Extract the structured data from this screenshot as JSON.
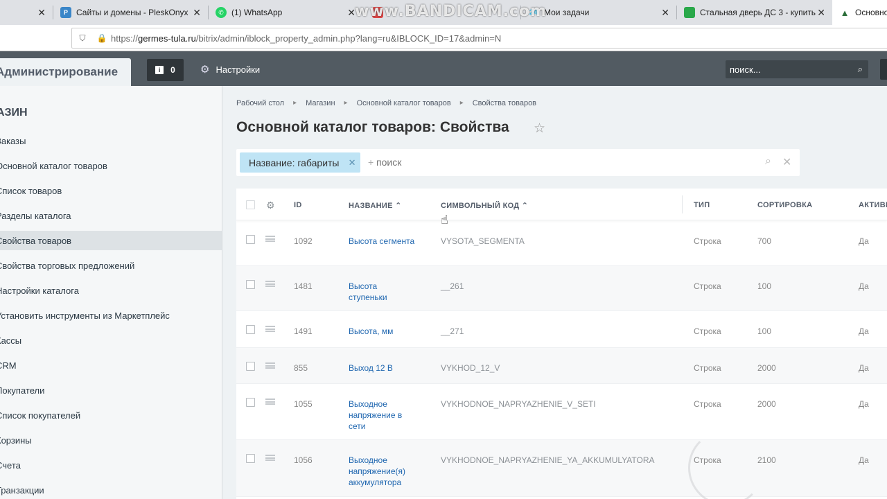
{
  "browser": {
    "tabs": [
      {
        "title": "Сайты и домены - PleskOnyx",
        "favicon": "plesk-icon"
      },
      {
        "title": "(1) WhatsApp",
        "favicon": "whatsapp-icon"
      },
      {
        "title": "",
        "favicon": "generic-icon"
      },
      {
        "title": "Мои задачи",
        "favicon": "bitrix24-icon"
      },
      {
        "title": "Стальная дверь ДС 3 - купить",
        "favicon": "green-square-icon"
      },
      {
        "title": "Основной",
        "favicon": "triangle-icon"
      }
    ],
    "watermark": "www.BANDICAM.com",
    "url_prefix": "https://",
    "url_host": "germes-tula.ru",
    "url_path": "/bitrix/admin/iblock_property_admin.php?lang=ru&IBLOCK_ID=17&admin=N"
  },
  "header": {
    "admin_title": "Администрирование",
    "notification_count": "0",
    "settings_label": "Настройки",
    "search_placeholder": "поиск..."
  },
  "menu": {
    "heading": "МАГАЗИН",
    "items": [
      "Заказы",
      "Основной каталог товаров",
      "Список товаров",
      "Разделы каталога",
      "Свойства товаров",
      "Свойства торговых предложений",
      "Настройки каталога",
      "Установить инструменты из Маркетплейс",
      "Кассы",
      "CRM",
      "Покупатели",
      "Список покупателей",
      "Корзины",
      "Счета",
      "Транзакции"
    ],
    "active_index": 4
  },
  "breadcrumbs": [
    "Рабочий стол",
    "Магазин",
    "Основной каталог товаров",
    "Свойства товаров"
  ],
  "page_title": "Основной каталог товаров: Свойства",
  "filter": {
    "tag": "Название: габариты",
    "plus": "+",
    "placeholder": "поиск"
  },
  "grid": {
    "columns": [
      "ID",
      "НАЗВАНИЕ",
      "СИМВОЛЬНЫЙ КОД",
      "ТИП",
      "СОРТИРОВКА",
      "АКТИВН"
    ],
    "sort_arrow": "^",
    "rows": [
      {
        "id": "1092",
        "name": "Высота сегмента",
        "code": "VYSOTA_SEGMENTA",
        "type": "Строка",
        "sort": "700",
        "active": "Да"
      },
      {
        "id": "1481",
        "name": "Высота ступеньки",
        "code": "__261",
        "type": "Строка",
        "sort": "100",
        "active": "Да"
      },
      {
        "id": "1491",
        "name": "Высота, мм",
        "code": "__271",
        "type": "Строка",
        "sort": "100",
        "active": "Да"
      },
      {
        "id": "855",
        "name": "Выход 12 В",
        "code": "VYKHOD_12_V",
        "type": "Строка",
        "sort": "2000",
        "active": "Да"
      },
      {
        "id": "1055",
        "name": "Выходное напряжение в сети",
        "code": "VYKHODNOE_NAPRYAZHENIE_V_SETI",
        "type": "Строка",
        "sort": "2000",
        "active": "Да"
      },
      {
        "id": "1056",
        "name": "Выходное напряжение(я) аккумулятора",
        "code": "VYKHODNOE_NAPRYAZHENIE_YA_AKKUMULYATORA",
        "type": "Строка",
        "sort": "2100",
        "active": "Да"
      }
    ]
  },
  "colors": {
    "header_bg": "#525b62",
    "filter_tag_bg": "#bfe4f5",
    "link": "#2067b0",
    "menu_active_bg": "#dde2e5"
  }
}
